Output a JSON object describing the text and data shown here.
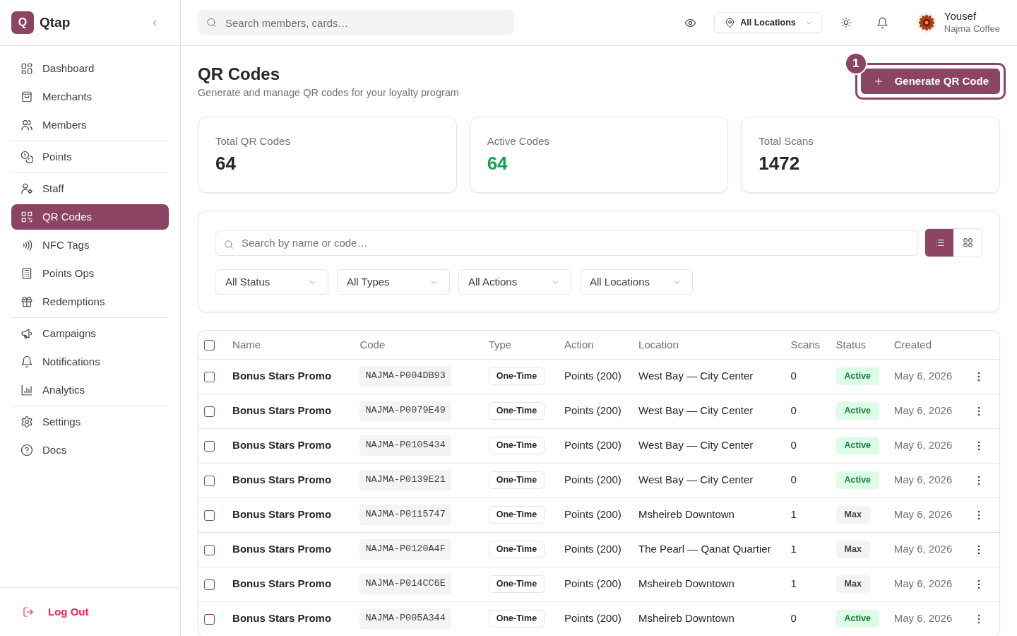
{
  "app": {
    "logo_letter": "Q",
    "name": "Qtap"
  },
  "sidebar": {
    "groups": [
      {
        "items": [
          {
            "label": "Dashboard",
            "selected": false
          },
          {
            "label": "Merchants",
            "selected": false
          },
          {
            "label": "Members",
            "selected": false
          }
        ]
      },
      {
        "items": [
          {
            "label": "Points",
            "selected": false
          }
        ]
      },
      {
        "items": [
          {
            "label": "Staff",
            "selected": false
          },
          {
            "label": "QR Codes",
            "selected": true
          },
          {
            "label": "NFC Tags",
            "selected": false
          },
          {
            "label": "Points Ops",
            "selected": false
          },
          {
            "label": "Redemptions",
            "selected": false
          }
        ]
      },
      {
        "items": [
          {
            "label": "Campaigns",
            "selected": false
          },
          {
            "label": "Notifications",
            "selected": false
          },
          {
            "label": "Analytics",
            "selected": false
          }
        ]
      },
      {
        "items": [
          {
            "label": "Settings",
            "selected": false
          },
          {
            "label": "Docs",
            "selected": false
          }
        ]
      }
    ],
    "logout": {
      "label": "Log Out"
    }
  },
  "topbar": {
    "search": {
      "placeholder": "Search members, cards…"
    },
    "location": {
      "label": "All Locations"
    },
    "user": {
      "name": "Yousef",
      "business": "Najma Coffee"
    }
  },
  "page": {
    "title": "QR Codes",
    "subtitle": "Generate and manage QR codes for your loyalty program",
    "primary_action": {
      "label": "Generate QR Code",
      "callout": "1"
    }
  },
  "stats": [
    {
      "label": "Total QR Codes",
      "value": "64",
      "color": "#27272a"
    },
    {
      "label": "Active Codes",
      "value": "64",
      "color": "#16a34a"
    },
    {
      "label": "Total Scans",
      "value": "1472",
      "color": "#27272a"
    }
  ],
  "filters": {
    "search": {
      "placeholder": "Search by name or code…"
    },
    "view_modes": [
      {
        "kind": "list",
        "selected": true
      },
      {
        "kind": "grid",
        "selected": false
      }
    ],
    "selects": [
      {
        "label": "All Status"
      },
      {
        "label": "All Types"
      },
      {
        "label": "All Actions"
      },
      {
        "label": "All Locations"
      }
    ]
  },
  "table": {
    "header_checkbox": {
      "checked": false
    },
    "columns": [
      "Name",
      "Code",
      "Type",
      "Action",
      "Location",
      "Scans",
      "Status",
      "Created"
    ],
    "rows": [
      {
        "checked": false,
        "name": "Bonus Stars Promo",
        "code": "NAJMA-P004DB93",
        "type": "One-Time",
        "action": "Points (200)",
        "location": "West Bay — City Center",
        "scans": "0",
        "status": {
          "label": "Active",
          "kind": "active"
        },
        "created": "May 6, 2026"
      },
      {
        "checked": false,
        "name": "Bonus Stars Promo",
        "code": "NAJMA-P0079E49",
        "type": "One-Time",
        "action": "Points (200)",
        "location": "West Bay — City Center",
        "scans": "0",
        "status": {
          "label": "Active",
          "kind": "active"
        },
        "created": "May 6, 2026"
      },
      {
        "checked": false,
        "name": "Bonus Stars Promo",
        "code": "NAJMA-P0105434",
        "type": "One-Time",
        "action": "Points (200)",
        "location": "West Bay — City Center",
        "scans": "0",
        "status": {
          "label": "Active",
          "kind": "active"
        },
        "created": "May 6, 2026"
      },
      {
        "checked": false,
        "name": "Bonus Stars Promo",
        "code": "NAJMA-P0139E21",
        "type": "One-Time",
        "action": "Points (200)",
        "location": "West Bay — City Center",
        "scans": "0",
        "status": {
          "label": "Active",
          "kind": "active"
        },
        "created": "May 6, 2026"
      },
      {
        "checked": false,
        "name": "Bonus Stars Promo",
        "code": "NAJMA-P0115747",
        "type": "One-Time",
        "action": "Points (200)",
        "location": "Msheireb Downtown",
        "scans": "1",
        "status": {
          "label": "Max",
          "kind": "max"
        },
        "created": "May 6, 2026"
      },
      {
        "checked": false,
        "name": "Bonus Stars Promo",
        "code": "NAJMA-P0120A4F",
        "type": "One-Time",
        "action": "Points (200)",
        "location": "The Pearl — Qanat Quartier",
        "scans": "1",
        "status": {
          "label": "Max",
          "kind": "max"
        },
        "created": "May 6, 2026"
      },
      {
        "checked": false,
        "name": "Bonus Stars Promo",
        "code": "NAJMA-P014CC6E",
        "type": "One-Time",
        "action": "Points (200)",
        "location": "Msheireb Downtown",
        "scans": "1",
        "status": {
          "label": "Max",
          "kind": "max"
        },
        "created": "May 6, 2026"
      },
      {
        "checked": false,
        "name": "Bonus Stars Promo",
        "code": "NAJMA-P005A344",
        "type": "One-Time",
        "action": "Points (200)",
        "location": "Msheireb Downtown",
        "scans": "0",
        "status": {
          "label": "Active",
          "kind": "active"
        },
        "created": "May 6, 2026"
      }
    ]
  }
}
